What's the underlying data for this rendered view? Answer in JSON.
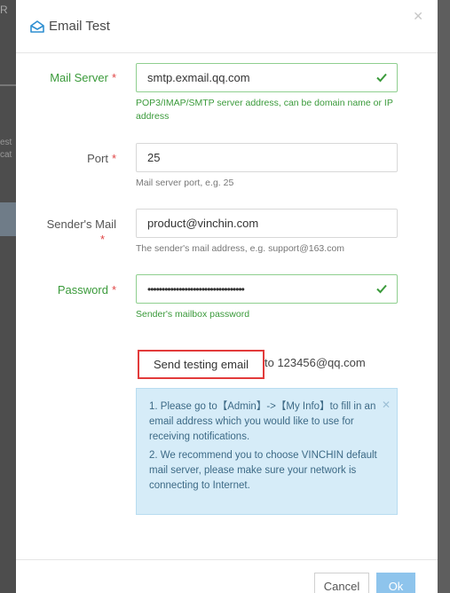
{
  "background": {
    "fragment_top": "R",
    "fragment_mid1": "est",
    "fragment_mid2": "cat"
  },
  "dialog": {
    "title": "Email Test",
    "title_icon": "mail-open-icon",
    "close_icon": "close-icon"
  },
  "form": {
    "mail_server": {
      "label": "Mail Server",
      "required_mark": "*",
      "value": "smtp.exmail.qq.com",
      "hint": "POP3/IMAP/SMTP server address, can be domain name or IP address",
      "valid": true
    },
    "port": {
      "label": "Port",
      "required_mark": "*",
      "value": "25",
      "hint": "Mail server port, e.g. 25"
    },
    "sender_mail": {
      "label": "Sender's Mail",
      "required_mark": "*",
      "value": "product@vinchin.com",
      "hint": "The sender's mail address, e.g. support@163.com"
    },
    "password": {
      "label": "Password",
      "required_mark": "*",
      "value": "••••••••••••••••••••••••••••••••••",
      "hint": "Sender's mailbox password",
      "valid": true
    }
  },
  "send_test": {
    "button_label": "Send testing email",
    "recipient_text": "to 123456@qq.com"
  },
  "notice": {
    "line1": "1. Please go to【Admin】->【My Info】to fill in an email address which you would like to use for receiving notifications.",
    "line2": "2. We recommend you to choose VINCHIN default mail server, please make sure your network is connecting to Internet."
  },
  "footer": {
    "cancel_label": "Cancel",
    "ok_label": "Ok"
  },
  "colors": {
    "valid_green": "#3a9a3a",
    "required_red": "#e04545",
    "highlight_red": "#e23b3b",
    "notice_bg": "#d6ecf8",
    "primary_button": "#8ec4ec"
  }
}
